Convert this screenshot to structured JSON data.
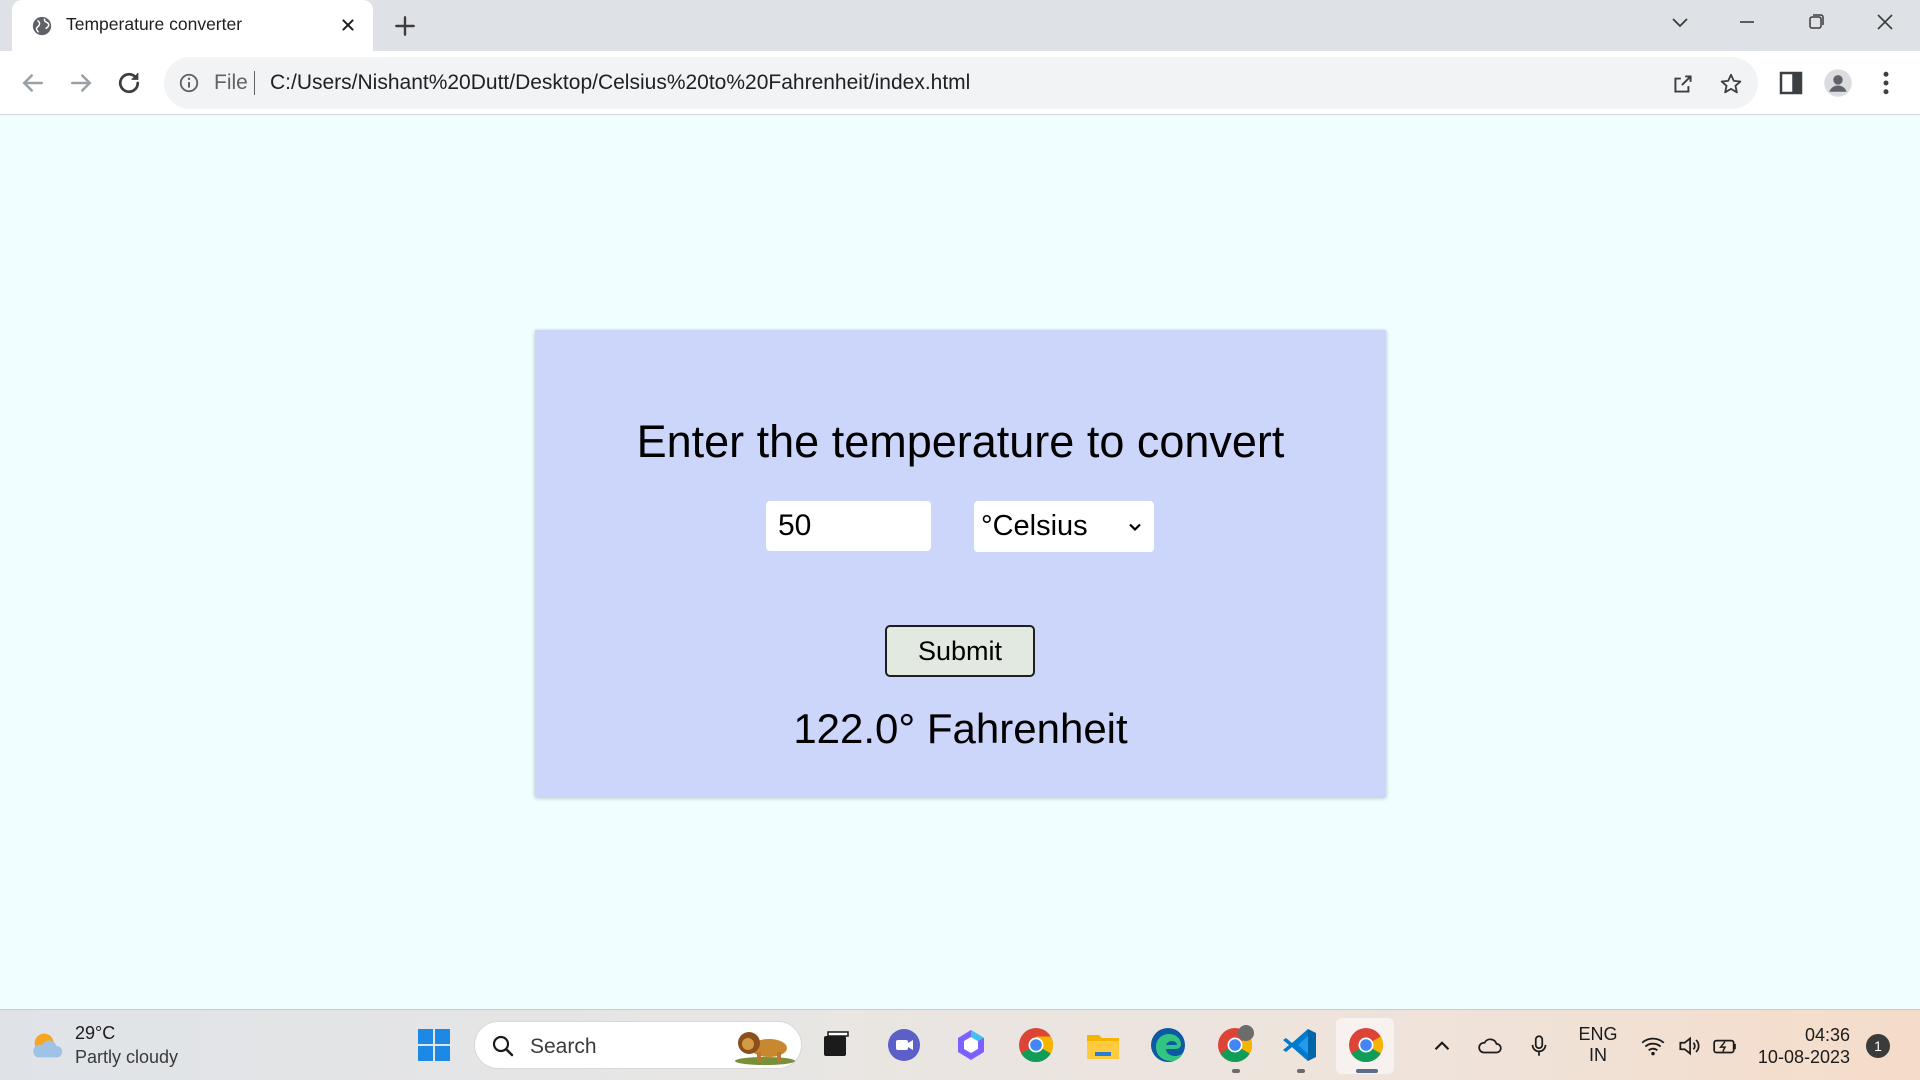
{
  "browser": {
    "tab": {
      "title": "Temperature converter"
    },
    "address": {
      "scheme": "File",
      "url": "C:/Users/Nishant%20Dutt/Desktop/Celsius%20to%20Fahrenheit/index.html"
    }
  },
  "page": {
    "heading": "Enter the temperature to convert",
    "input_value": "50",
    "unit_selected": "°Celsius",
    "submit_label": "Submit",
    "result": "122.0° Fahrenheit"
  },
  "taskbar": {
    "weather": {
      "temp": "29°C",
      "desc": "Partly cloudy"
    },
    "search_label": "Search",
    "lang": {
      "line1": "ENG",
      "line2": "IN"
    },
    "clock": {
      "time": "04:36",
      "date": "10-08-2023"
    },
    "notifications": "1",
    "pinned_apps": [
      "start-icon",
      "search-box",
      "task-view-icon",
      "teams-meet-icon",
      "copilot-icon",
      "chrome-icon",
      "file-explorer-icon",
      "edge-icon",
      "chrome-profile-icon",
      "vscode-icon",
      "chrome-active-icon"
    ]
  }
}
